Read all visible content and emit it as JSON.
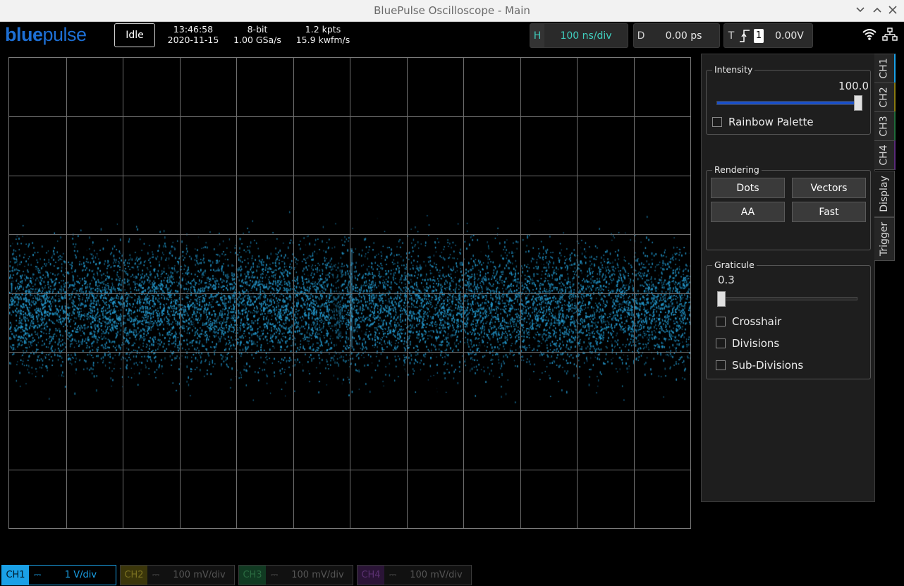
{
  "window": {
    "title": "BluePulse Oscilloscope - Main"
  },
  "logo": {
    "part1": "blue",
    "part2": "pulse"
  },
  "status": {
    "label": "Idle"
  },
  "info": {
    "time": "13:46:58",
    "date": "2020-11-15",
    "bits": "8-bit",
    "rate": "1.00 GSa/s",
    "points": "1.2 kpts",
    "wfm_rate": "15.9 kwfm/s"
  },
  "horizontal": {
    "key": "H",
    "value": "100 ns/div",
    "color": "#40d0c0"
  },
  "delay": {
    "key": "D",
    "value": "0.00 ps"
  },
  "trigger": {
    "key": "T",
    "channel": "1",
    "level": "0.00V"
  },
  "icons": {
    "wifi": "wifi-icon",
    "network": "network-icon"
  },
  "display_panel": {
    "intensity": {
      "label": "Intensity",
      "value": "100.0",
      "level": 1.0
    },
    "rainbow": {
      "label": "Rainbow Palette",
      "checked": false
    },
    "rendering": {
      "label": "Rendering",
      "buttons": [
        "Dots",
        "Vectors",
        "AA",
        "Fast"
      ]
    },
    "graticule": {
      "label": "Graticule",
      "value": "0.3",
      "level": 0.0,
      "checks": [
        {
          "label": "Crosshair"
        },
        {
          "label": "Divisions"
        },
        {
          "label": "Sub-Divisions"
        }
      ]
    }
  },
  "side_tabs": [
    "CH1",
    "CH2",
    "CH3",
    "CH4",
    "Display",
    "Trigger"
  ],
  "channels": [
    {
      "name": "CH1",
      "scale": "1 V/div",
      "color": "#1aa0e6",
      "active": true
    },
    {
      "name": "CH2",
      "scale": "100 mV/div",
      "color": "#8a7a10",
      "active": false
    },
    {
      "name": "CH3",
      "scale": "100 mV/div",
      "color": "#1f6b3a",
      "active": false
    },
    {
      "name": "CH4",
      "scale": "100 mV/div",
      "color": "#5a2a7a",
      "active": false
    }
  ]
}
